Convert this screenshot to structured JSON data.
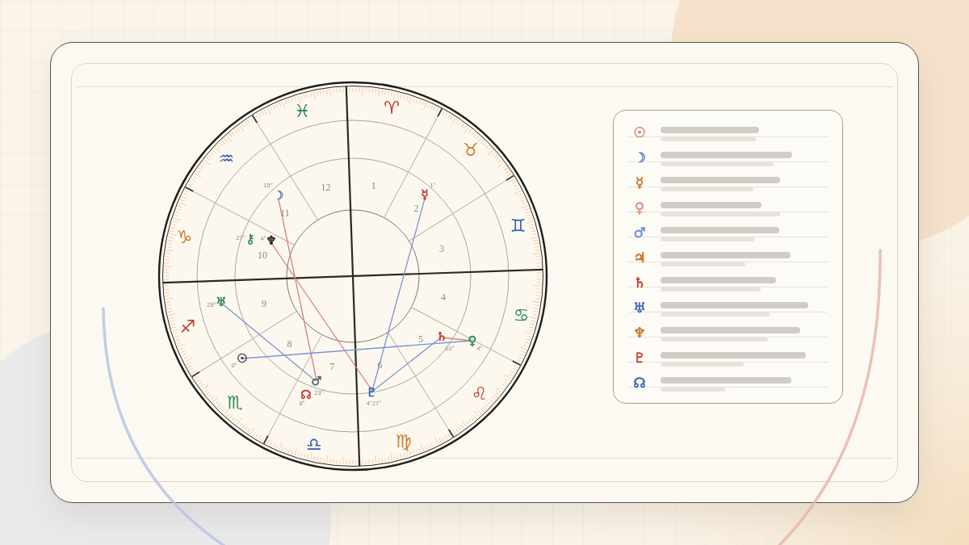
{
  "chart": {
    "signs": [
      {
        "symbol": "♈",
        "color": "#c0392b"
      },
      {
        "symbol": "♉",
        "color": "#d07a26"
      },
      {
        "symbol": "♊",
        "color": "#2f5fb3"
      },
      {
        "symbol": "♋",
        "color": "#2e8a57"
      },
      {
        "symbol": "♌",
        "color": "#c0392b"
      },
      {
        "symbol": "♍",
        "color": "#d07a26"
      },
      {
        "symbol": "♎",
        "color": "#2f5fb3"
      },
      {
        "symbol": "♏",
        "color": "#2e8a57"
      },
      {
        "symbol": "♐",
        "color": "#c0392b"
      },
      {
        "symbol": "♑",
        "color": "#d07a26"
      },
      {
        "symbol": "♒",
        "color": "#2f5fb3"
      },
      {
        "symbol": "♓",
        "color": "#2e8a57"
      }
    ],
    "houses": [
      "1",
      "2",
      "3",
      "4",
      "5",
      "6",
      "7",
      "8",
      "9",
      "10",
      "11",
      "12"
    ],
    "planets": [
      {
        "symbol": "☽",
        "degree": "15°",
        "color": "#5b7fd0"
      },
      {
        "symbol": "☿",
        "degree": "1°",
        "color": "#c0392b"
      },
      {
        "symbol": "⚷",
        "degree": "27°",
        "color": "#2e8a57"
      },
      {
        "symbol": "♆",
        "degree": "4°",
        "color": "#222222"
      },
      {
        "symbol": "♅",
        "degree": "28°",
        "color": "#2e8a57"
      },
      {
        "symbol": "☉",
        "degree": "0°",
        "color": "#444444"
      },
      {
        "symbol": "♂",
        "degree": "23°",
        "color": "#666666"
      },
      {
        "symbol": "☊",
        "degree": "8°",
        "color": "#c0392b"
      },
      {
        "symbol": "♇",
        "degree": "4°27°",
        "color": "#2f5fb3"
      },
      {
        "symbol": "♄",
        "degree": "10°",
        "color": "#c0392b"
      },
      {
        "symbol": "♀",
        "degree": "4°",
        "color": "#2e8a57"
      }
    ],
    "aspects": [
      {
        "color": "#d4817a"
      },
      {
        "color": "#d4817a"
      },
      {
        "color": "#7a96d0"
      },
      {
        "color": "#7a96d0"
      },
      {
        "color": "#7a96d0"
      },
      {
        "color": "#7a96d0"
      },
      {
        "color": "#d4817a"
      }
    ]
  },
  "legend": {
    "items": [
      {
        "symbol": "☉",
        "color": "#d9806a"
      },
      {
        "symbol": "☽",
        "color": "#5b7fd0"
      },
      {
        "symbol": "☿",
        "color": "#c8782a"
      },
      {
        "symbol": "♀",
        "color": "#e0907f"
      },
      {
        "symbol": "♂",
        "color": "#7391d6"
      },
      {
        "symbol": "♃",
        "color": "#c56a1e"
      },
      {
        "symbol": "♄",
        "color": "#b8412f"
      },
      {
        "symbol": "♅",
        "color": "#3b64b5"
      },
      {
        "symbol": "♆",
        "color": "#c8782a"
      },
      {
        "symbol": "♇",
        "color": "#b8412f"
      },
      {
        "symbol": "☊",
        "color": "#3b64b5"
      }
    ]
  }
}
